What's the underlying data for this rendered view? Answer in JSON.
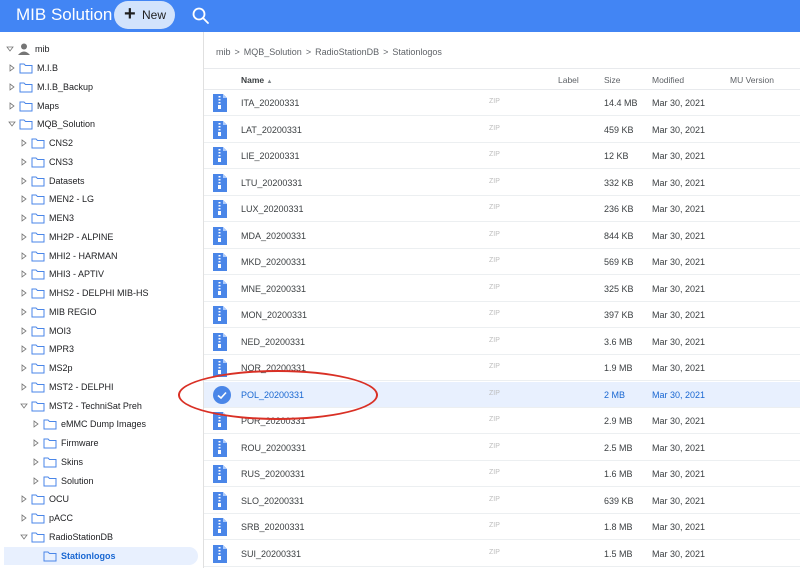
{
  "app": {
    "title": "MIB Solution",
    "new_label": "New"
  },
  "icons": {
    "new": "plus-icon",
    "search": "search-icon",
    "user": "user-icon",
    "folder": "folder-icon",
    "file": "zip-file-icon",
    "check": "check-icon"
  },
  "colors": {
    "topbar": "#4285f4",
    "accent": "#1967d2",
    "selected_bg": "#e8f0fe",
    "folder": "#4a86e8",
    "annotation": "#d93025"
  },
  "sidebar": {
    "root": "mib",
    "items": [
      {
        "label": "M.I.B",
        "expanded": false
      },
      {
        "label": "M.I.B_Backup",
        "expanded": false
      },
      {
        "label": "Maps",
        "expanded": false
      },
      {
        "label": "MQB_Solution",
        "expanded": true
      },
      {
        "label": "CNS2",
        "expanded": false
      },
      {
        "label": "CNS3",
        "expanded": false
      },
      {
        "label": "Datasets",
        "expanded": false
      },
      {
        "label": "MEN2 - LG",
        "expanded": false
      },
      {
        "label": "MEN3",
        "expanded": false
      },
      {
        "label": "MH2P - ALPINE",
        "expanded": false
      },
      {
        "label": "MHI2 - HARMAN",
        "expanded": false
      },
      {
        "label": "MHI3 - APTIV",
        "expanded": false
      },
      {
        "label": "MHS2 - DELPHI MIB-HS",
        "expanded": false
      },
      {
        "label": "MIB REGIO",
        "expanded": false
      },
      {
        "label": "MOI3",
        "expanded": false
      },
      {
        "label": "MPR3",
        "expanded": false
      },
      {
        "label": "MS2p",
        "expanded": false
      },
      {
        "label": "MST2 - DELPHI",
        "expanded": false
      },
      {
        "label": "MST2 - TechniSat Preh",
        "expanded": true
      },
      {
        "label": "eMMC Dump Images",
        "expanded": false
      },
      {
        "label": "Firmware",
        "expanded": false
      },
      {
        "label": "Skins",
        "expanded": false
      },
      {
        "label": "Solution",
        "expanded": false
      },
      {
        "label": "OCU",
        "expanded": false
      },
      {
        "label": "pACC",
        "expanded": false
      },
      {
        "label": "RadioStationDB",
        "expanded": true
      },
      {
        "label": "Stationlogos",
        "expanded": false,
        "selected": true
      }
    ]
  },
  "breadcrumb": [
    "mib",
    "MQB_Solution",
    "RadioStationDB",
    "Stationlogos"
  ],
  "breadcrumb_separator": ">",
  "columns": {
    "name": "Name",
    "sort_indicator": "▲",
    "label": "Label",
    "size": "Size",
    "modified": "Modified",
    "mu_version": "MU Version"
  },
  "files": [
    {
      "name": "ITA_20200331",
      "type": "ZIP",
      "size": "14.4 MB",
      "modified": "Mar 30, 2021"
    },
    {
      "name": "LAT_20200331",
      "type": "ZIP",
      "size": "459 KB",
      "modified": "Mar 30, 2021"
    },
    {
      "name": "LIE_20200331",
      "type": "ZIP",
      "size": "12 KB",
      "modified": "Mar 30, 2021"
    },
    {
      "name": "LTU_20200331",
      "type": "ZIP",
      "size": "332 KB",
      "modified": "Mar 30, 2021"
    },
    {
      "name": "LUX_20200331",
      "type": "ZIP",
      "size": "236 KB",
      "modified": "Mar 30, 2021"
    },
    {
      "name": "MDA_20200331",
      "type": "ZIP",
      "size": "844 KB",
      "modified": "Mar 30, 2021"
    },
    {
      "name": "MKD_20200331",
      "type": "ZIP",
      "size": "569 KB",
      "modified": "Mar 30, 2021"
    },
    {
      "name": "MNE_20200331",
      "type": "ZIP",
      "size": "325 KB",
      "modified": "Mar 30, 2021"
    },
    {
      "name": "MON_20200331",
      "type": "ZIP",
      "size": "397 KB",
      "modified": "Mar 30, 2021"
    },
    {
      "name": "NED_20200331",
      "type": "ZIP",
      "size": "3.6 MB",
      "modified": "Mar 30, 2021"
    },
    {
      "name": "NOR_20200331",
      "type": "ZIP",
      "size": "1.9 MB",
      "modified": "Mar 30, 2021"
    },
    {
      "name": "POL_20200331",
      "type": "ZIP",
      "size": "2 MB",
      "modified": "Mar 30, 2021",
      "selected": true
    },
    {
      "name": "POR_20200331",
      "type": "ZIP",
      "size": "2.9 MB",
      "modified": "Mar 30, 2021"
    },
    {
      "name": "ROU_20200331",
      "type": "ZIP",
      "size": "2.5 MB",
      "modified": "Mar 30, 2021"
    },
    {
      "name": "RUS_20200331",
      "type": "ZIP",
      "size": "1.6 MB",
      "modified": "Mar 30, 2021"
    },
    {
      "name": "SLO_20200331",
      "type": "ZIP",
      "size": "639 KB",
      "modified": "Mar 30, 2021"
    },
    {
      "name": "SRB_20200331",
      "type": "ZIP",
      "size": "1.8 MB",
      "modified": "Mar 30, 2021"
    },
    {
      "name": "SUI_20200331",
      "type": "ZIP",
      "size": "1.5 MB",
      "modified": "Mar 30, 2021"
    }
  ]
}
